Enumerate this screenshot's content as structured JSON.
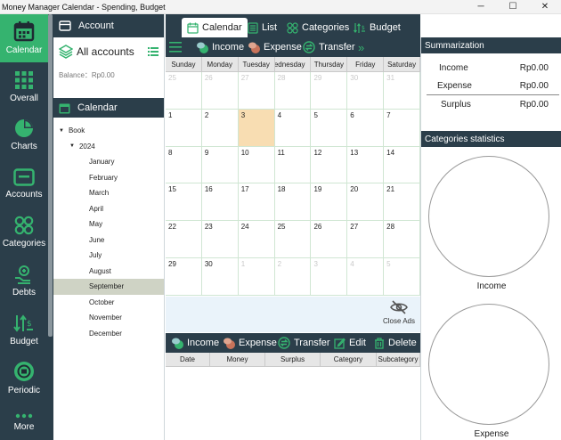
{
  "window": {
    "title": "Money Manager Calendar - Spending, Budget",
    "minimize": "─",
    "maximize": "☐",
    "close": "✕"
  },
  "nav": [
    {
      "label": "Calendar",
      "icon": "calendar-icon",
      "active": true
    },
    {
      "label": "Overall",
      "icon": "grid-icon"
    },
    {
      "label": "Charts",
      "icon": "pie-chart-icon"
    },
    {
      "label": "Accounts",
      "icon": "accounts-icon"
    },
    {
      "label": "Categories",
      "icon": "categories-icon"
    },
    {
      "label": "Debts",
      "icon": "debts-icon"
    },
    {
      "label": "Budget",
      "icon": "budget-icon"
    },
    {
      "label": "Periodic",
      "icon": "periodic-icon"
    },
    {
      "label": "More",
      "icon": "more-icon"
    }
  ],
  "sidebar": {
    "account_header": "Account",
    "all_accounts": "All accounts",
    "balance": "Balance：Rp0.00",
    "calendar_header": "Calendar",
    "book": "Book",
    "year": "2024",
    "months": [
      "January",
      "February",
      "March",
      "April",
      "May",
      "June",
      "July",
      "August",
      "September",
      "October",
      "November",
      "December"
    ],
    "selected_month": "September"
  },
  "tabs": [
    {
      "label": "Calendar",
      "icon": "calendar-icon",
      "active": true
    },
    {
      "label": "List",
      "icon": "list-icon"
    },
    {
      "label": "Categories",
      "icon": "categories-icon"
    },
    {
      "label": "Budget",
      "icon": "budget-icon"
    }
  ],
  "toolbar": {
    "income": "Income",
    "expense": "Expense",
    "transfer": "Transfer",
    "more": "»"
  },
  "calendar": {
    "weekdays": [
      "Sunday",
      "Monday",
      "Tuesday",
      "Wednesday",
      "Thursday",
      "Friday",
      "Saturday"
    ],
    "weeks": [
      [
        {
          "d": "25",
          "dim": true
        },
        {
          "d": "26",
          "dim": true
        },
        {
          "d": "27",
          "dim": true
        },
        {
          "d": "28",
          "dim": true
        },
        {
          "d": "29",
          "dim": true
        },
        {
          "d": "30",
          "dim": true
        },
        {
          "d": "31",
          "dim": true
        }
      ],
      [
        {
          "d": "1"
        },
        {
          "d": "2"
        },
        {
          "d": "3",
          "today": true
        },
        {
          "d": "4"
        },
        {
          "d": "5"
        },
        {
          "d": "6"
        },
        {
          "d": "7"
        }
      ],
      [
        {
          "d": "8"
        },
        {
          "d": "9"
        },
        {
          "d": "10"
        },
        {
          "d": "11"
        },
        {
          "d": "12"
        },
        {
          "d": "13"
        },
        {
          "d": "14"
        }
      ],
      [
        {
          "d": "15"
        },
        {
          "d": "16"
        },
        {
          "d": "17"
        },
        {
          "d": "18"
        },
        {
          "d": "19"
        },
        {
          "d": "20"
        },
        {
          "d": "21"
        }
      ],
      [
        {
          "d": "22"
        },
        {
          "d": "23"
        },
        {
          "d": "24"
        },
        {
          "d": "25"
        },
        {
          "d": "26"
        },
        {
          "d": "27"
        },
        {
          "d": "28"
        }
      ],
      [
        {
          "d": "29"
        },
        {
          "d": "30"
        },
        {
          "d": "1",
          "dim": true
        },
        {
          "d": "2",
          "dim": true
        },
        {
          "d": "3",
          "dim": true
        },
        {
          "d": "4",
          "dim": true
        },
        {
          "d": "5",
          "dim": true
        }
      ]
    ]
  },
  "ads": {
    "close_label": "Close Ads"
  },
  "toolbar2": {
    "income": "Income",
    "expense": "Expense",
    "transfer": "Transfer",
    "edit": "Edit",
    "delete": "Delete"
  },
  "table": {
    "columns": [
      "Date",
      "Money",
      "Surplus",
      "Category",
      "Subcategory"
    ]
  },
  "summary": {
    "header": "Summarization",
    "income_label": "Income",
    "income_value": "Rp0.00",
    "expense_label": "Expense",
    "expense_value": "Rp0.00",
    "surplus_label": "Surplus",
    "surplus_value": "Rp0.00"
  },
  "stats": {
    "header": "Categories statistics",
    "income_label": "Income",
    "expense_label": "Expense"
  },
  "colors": {
    "accent": "#35b36f",
    "dark": "#2b3e4a",
    "today": "#f8ddb2"
  }
}
